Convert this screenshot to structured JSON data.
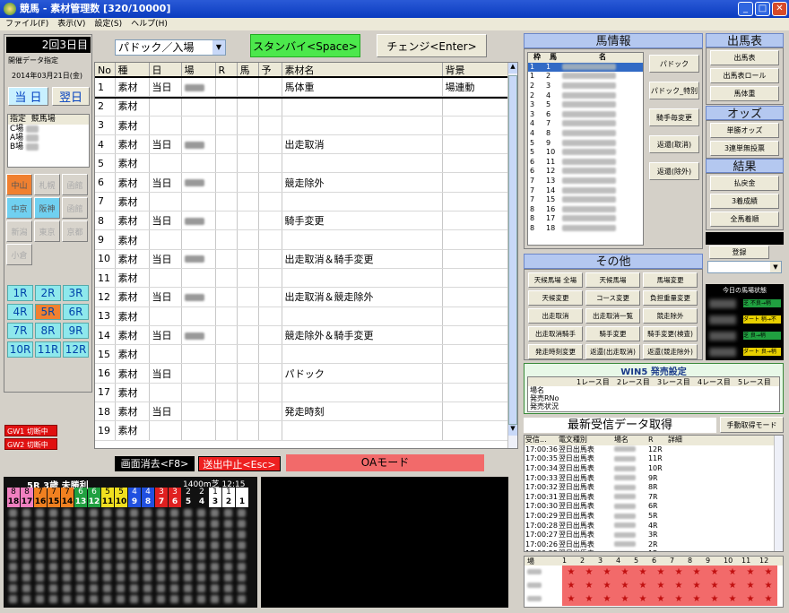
{
  "window": {
    "title": "競馬 - 素材管理数 [320/10000]"
  },
  "menu": [
    "ファイル(F)",
    "表示(V)",
    "設定(S)",
    "ヘルプ(H)"
  ],
  "left": {
    "day_label": "2回3日目",
    "designation_header": "開催データ指定",
    "date": "2014年03月21日(金)",
    "today_btn": "当 日",
    "nextday_btn": "翌日",
    "venue_hdr1": "指定",
    "venue_hdr2": "競馬場",
    "venue_rows": [
      "C場",
      "A場",
      "B場"
    ],
    "venues": [
      "中山",
      "札幌",
      "函館",
      "中京",
      "阪神",
      "函館",
      "新潟",
      "東京",
      "京都",
      "小倉"
    ],
    "races": [
      "1R",
      "2R",
      "3R",
      "4R",
      "5R",
      "6R",
      "7R",
      "8R",
      "9R",
      "10R",
      "11R",
      "12R"
    ],
    "gw1": "GW1 切断中",
    "gw2": "GW2 切断中"
  },
  "toolbar": {
    "dropdown": "パドック／入場",
    "standby": "スタンバイ<Space>",
    "change": "チェンジ<Enter>"
  },
  "table": {
    "headers": [
      "No",
      "種",
      "日",
      "場",
      "R",
      "馬",
      "予",
      "素材名",
      "背景"
    ],
    "rows": [
      {
        "no": "1",
        "kind": "素材",
        "day": "当日",
        "place": "blur",
        "name": "馬体重",
        "bg": "場連動"
      },
      {
        "no": "2",
        "kind": "素材",
        "day": "",
        "place": "",
        "name": "",
        "bg": ""
      },
      {
        "no": "3",
        "kind": "素材",
        "day": "",
        "place": "",
        "name": "",
        "bg": ""
      },
      {
        "no": "4",
        "kind": "素材",
        "day": "当日",
        "place": "blur",
        "name": "出走取消",
        "bg": ""
      },
      {
        "no": "5",
        "kind": "素材",
        "day": "",
        "place": "",
        "name": "",
        "bg": ""
      },
      {
        "no": "6",
        "kind": "素材",
        "day": "当日",
        "place": "blur",
        "name": "競走除外",
        "bg": ""
      },
      {
        "no": "7",
        "kind": "素材",
        "day": "",
        "place": "",
        "name": "",
        "bg": ""
      },
      {
        "no": "8",
        "kind": "素材",
        "day": "当日",
        "place": "blur",
        "name": "騎手変更",
        "bg": ""
      },
      {
        "no": "9",
        "kind": "素材",
        "day": "",
        "place": "",
        "name": "",
        "bg": ""
      },
      {
        "no": "10",
        "kind": "素材",
        "day": "当日",
        "place": "blur",
        "name": "出走取消＆騎手変更",
        "bg": ""
      },
      {
        "no": "11",
        "kind": "素材",
        "day": "",
        "place": "",
        "name": "",
        "bg": ""
      },
      {
        "no": "12",
        "kind": "素材",
        "day": "当日",
        "place": "blur",
        "name": "出走取消＆競走除外",
        "bg": ""
      },
      {
        "no": "13",
        "kind": "素材",
        "day": "",
        "place": "",
        "name": "",
        "bg": ""
      },
      {
        "no": "14",
        "kind": "素材",
        "day": "当日",
        "place": "blur",
        "name": "競走除外＆騎手変更",
        "bg": ""
      },
      {
        "no": "15",
        "kind": "素材",
        "day": "",
        "place": "",
        "name": "",
        "bg": ""
      },
      {
        "no": "16",
        "kind": "素材",
        "day": "当日",
        "place": "",
        "name": "パドック",
        "bg": ""
      },
      {
        "no": "17",
        "kind": "素材",
        "day": "",
        "place": "",
        "name": "",
        "bg": ""
      },
      {
        "no": "18",
        "kind": "素材",
        "day": "当日",
        "place": "",
        "name": "発走時刻",
        "bg": ""
      },
      {
        "no": "19",
        "kind": "素材",
        "day": "",
        "place": "",
        "name": "",
        "bg": ""
      }
    ]
  },
  "bottom": {
    "clear": "画面消去<F8>",
    "stop": "送出中止<Esc>",
    "oa": "OAモード",
    "race_info": "5R 3歳 未勝利",
    "race_dist": "1400m芝 12:15",
    "waku": [
      "8",
      "8",
      "7",
      "7",
      "7",
      "6",
      "6",
      "5",
      "5",
      "4",
      "4",
      "3",
      "3",
      "2",
      "2",
      "1",
      "1"
    ],
    "umaban": [
      "18",
      "17",
      "16",
      "15",
      "14",
      "13",
      "12",
      "11",
      "10",
      "9",
      "8",
      "7",
      "6",
      "5",
      "4",
      "3",
      "2",
      "1"
    ]
  },
  "horse_info": {
    "title": "馬情報",
    "headers": [
      "枠",
      "馬",
      "名"
    ],
    "waku": [
      "1",
      "1",
      "2",
      "2",
      "3",
      "3",
      "4",
      "4",
      "5",
      "5",
      "6",
      "6",
      "7",
      "7",
      "7",
      "8",
      "8",
      "8"
    ],
    "uma": [
      "1",
      "2",
      "3",
      "4",
      "5",
      "6",
      "7",
      "8",
      "9",
      "10",
      "11",
      "12",
      "13",
      "14",
      "15",
      "16",
      "17",
      "18"
    ],
    "buttons": [
      "パドック",
      "パドック_特別",
      "騎手毎変更",
      "返還(取消)",
      "返還(除外)"
    ]
  },
  "shutsuba": {
    "title": "出馬表",
    "buttons": [
      "出馬表",
      "出馬表ロール",
      "馬体重"
    ]
  },
  "odds": {
    "title": "オッズ",
    "buttons": [
      "単勝オッズ",
      "3連単無投票"
    ]
  },
  "result": {
    "title": "結果",
    "buttons": [
      "払戻金",
      "3着成績",
      "全馬着順"
    ]
  },
  "register": {
    "button": "登録"
  },
  "today_status": {
    "title": "今日の馬場状態",
    "labels": [
      "芝 不良→稍",
      "ダート 稍→不良",
      "芝 良→稍",
      "ダート 良→稍"
    ]
  },
  "other": {
    "title": "その他",
    "buttons": [
      "天候馬場 全場",
      "天候馬場",
      "馬場変更",
      "天候変更",
      "コース変更",
      "負担重量変更",
      "出走取消",
      "出走取消一覧",
      "競走除外",
      "出走取消騎手",
      "騎手変更",
      "騎手変更(検査)",
      "発走時刻変更",
      "返還(出走取消)",
      "返還(競走除外)"
    ]
  },
  "win5": {
    "title": "WIN5 発売設定",
    "cols": [
      "1レース目",
      "2レース目",
      "3レース目",
      "4レース目",
      "5レース目"
    ],
    "rows": [
      "場名",
      "発売RNo",
      "発売状況"
    ]
  },
  "latest": {
    "title": "最新受信データ取得",
    "manual": "手動取得モード",
    "headers": [
      "受信...",
      "電文種別",
      "場名",
      "R",
      "詳細"
    ],
    "rows": [
      {
        "t": "17:00:36",
        "type": "翌日出馬表",
        "r": "12R"
      },
      {
        "t": "17:00:35",
        "type": "翌日出馬表",
        "r": "11R"
      },
      {
        "t": "17:00:34",
        "type": "翌日出馬表",
        "r": "10R"
      },
      {
        "t": "17:00:33",
        "type": "翌日出馬表",
        "r": "9R"
      },
      {
        "t": "17:00:32",
        "type": "翌日出馬表",
        "r": "8R"
      },
      {
        "t": "17:00:31",
        "type": "翌日出馬表",
        "r": "7R"
      },
      {
        "t": "17:00:30",
        "type": "翌日出馬表",
        "r": "6R"
      },
      {
        "t": "17:00:29",
        "type": "翌日出馬表",
        "r": "5R"
      },
      {
        "t": "17:00:28",
        "type": "翌日出馬表",
        "r": "4R"
      },
      {
        "t": "17:00:27",
        "type": "翌日出馬表",
        "r": "3R"
      },
      {
        "t": "17:00:26",
        "type": "翌日出馬表",
        "r": "2R"
      },
      {
        "t": "17:00:25",
        "type": "翌日出馬表",
        "r": "1R"
      },
      {
        "t": "17:00:24",
        "type": "翌日出馬表",
        "r": "12R"
      }
    ]
  },
  "grid": {
    "header": "場",
    "cols": [
      "1",
      "2",
      "3",
      "4",
      "5",
      "6",
      "7",
      "8",
      "9",
      "10",
      "11",
      "12"
    ],
    "star": "★"
  }
}
